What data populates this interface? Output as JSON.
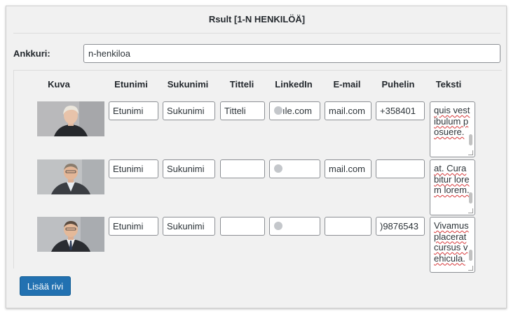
{
  "panel": {
    "title": "Rsult [1-N HENKILÖÄ]"
  },
  "anchor": {
    "label": "Ankkuri:",
    "value": "n-henkiloa"
  },
  "table": {
    "headers": [
      "Kuva",
      "Etunimi",
      "Sukunimi",
      "Titteli",
      "LinkedIn",
      "E-mail",
      "Puhelin",
      "Teksti"
    ],
    "rows": [
      {
        "etunimi": "Etunimi",
        "sukunimi": "Sukunimi",
        "titteli": "Titteli",
        "linkedin": "ıle.com",
        "email": "mail.com",
        "puhelin": "+358401",
        "teksti": "quis vestibulum posuere."
      },
      {
        "etunimi": "Etunimi",
        "sukunimi": "Sukunimi",
        "titteli": "",
        "linkedin": "",
        "email": "mail.com",
        "puhelin": "",
        "teksti": "at. Curabitur lorem lorem."
      },
      {
        "etunimi": "Etunimi",
        "sukunimi": "Sukunimi",
        "titteli": "",
        "linkedin": "",
        "email": "",
        "puhelin": ")9876543",
        "teksti": "Vivamus placerat cursus vehicula."
      }
    ]
  },
  "add_button": {
    "label": "Lisää rivi"
  },
  "colors": {
    "accent": "#2271b1",
    "panel_bg": "#f1f1f1",
    "spellcheck": "#d63638"
  }
}
